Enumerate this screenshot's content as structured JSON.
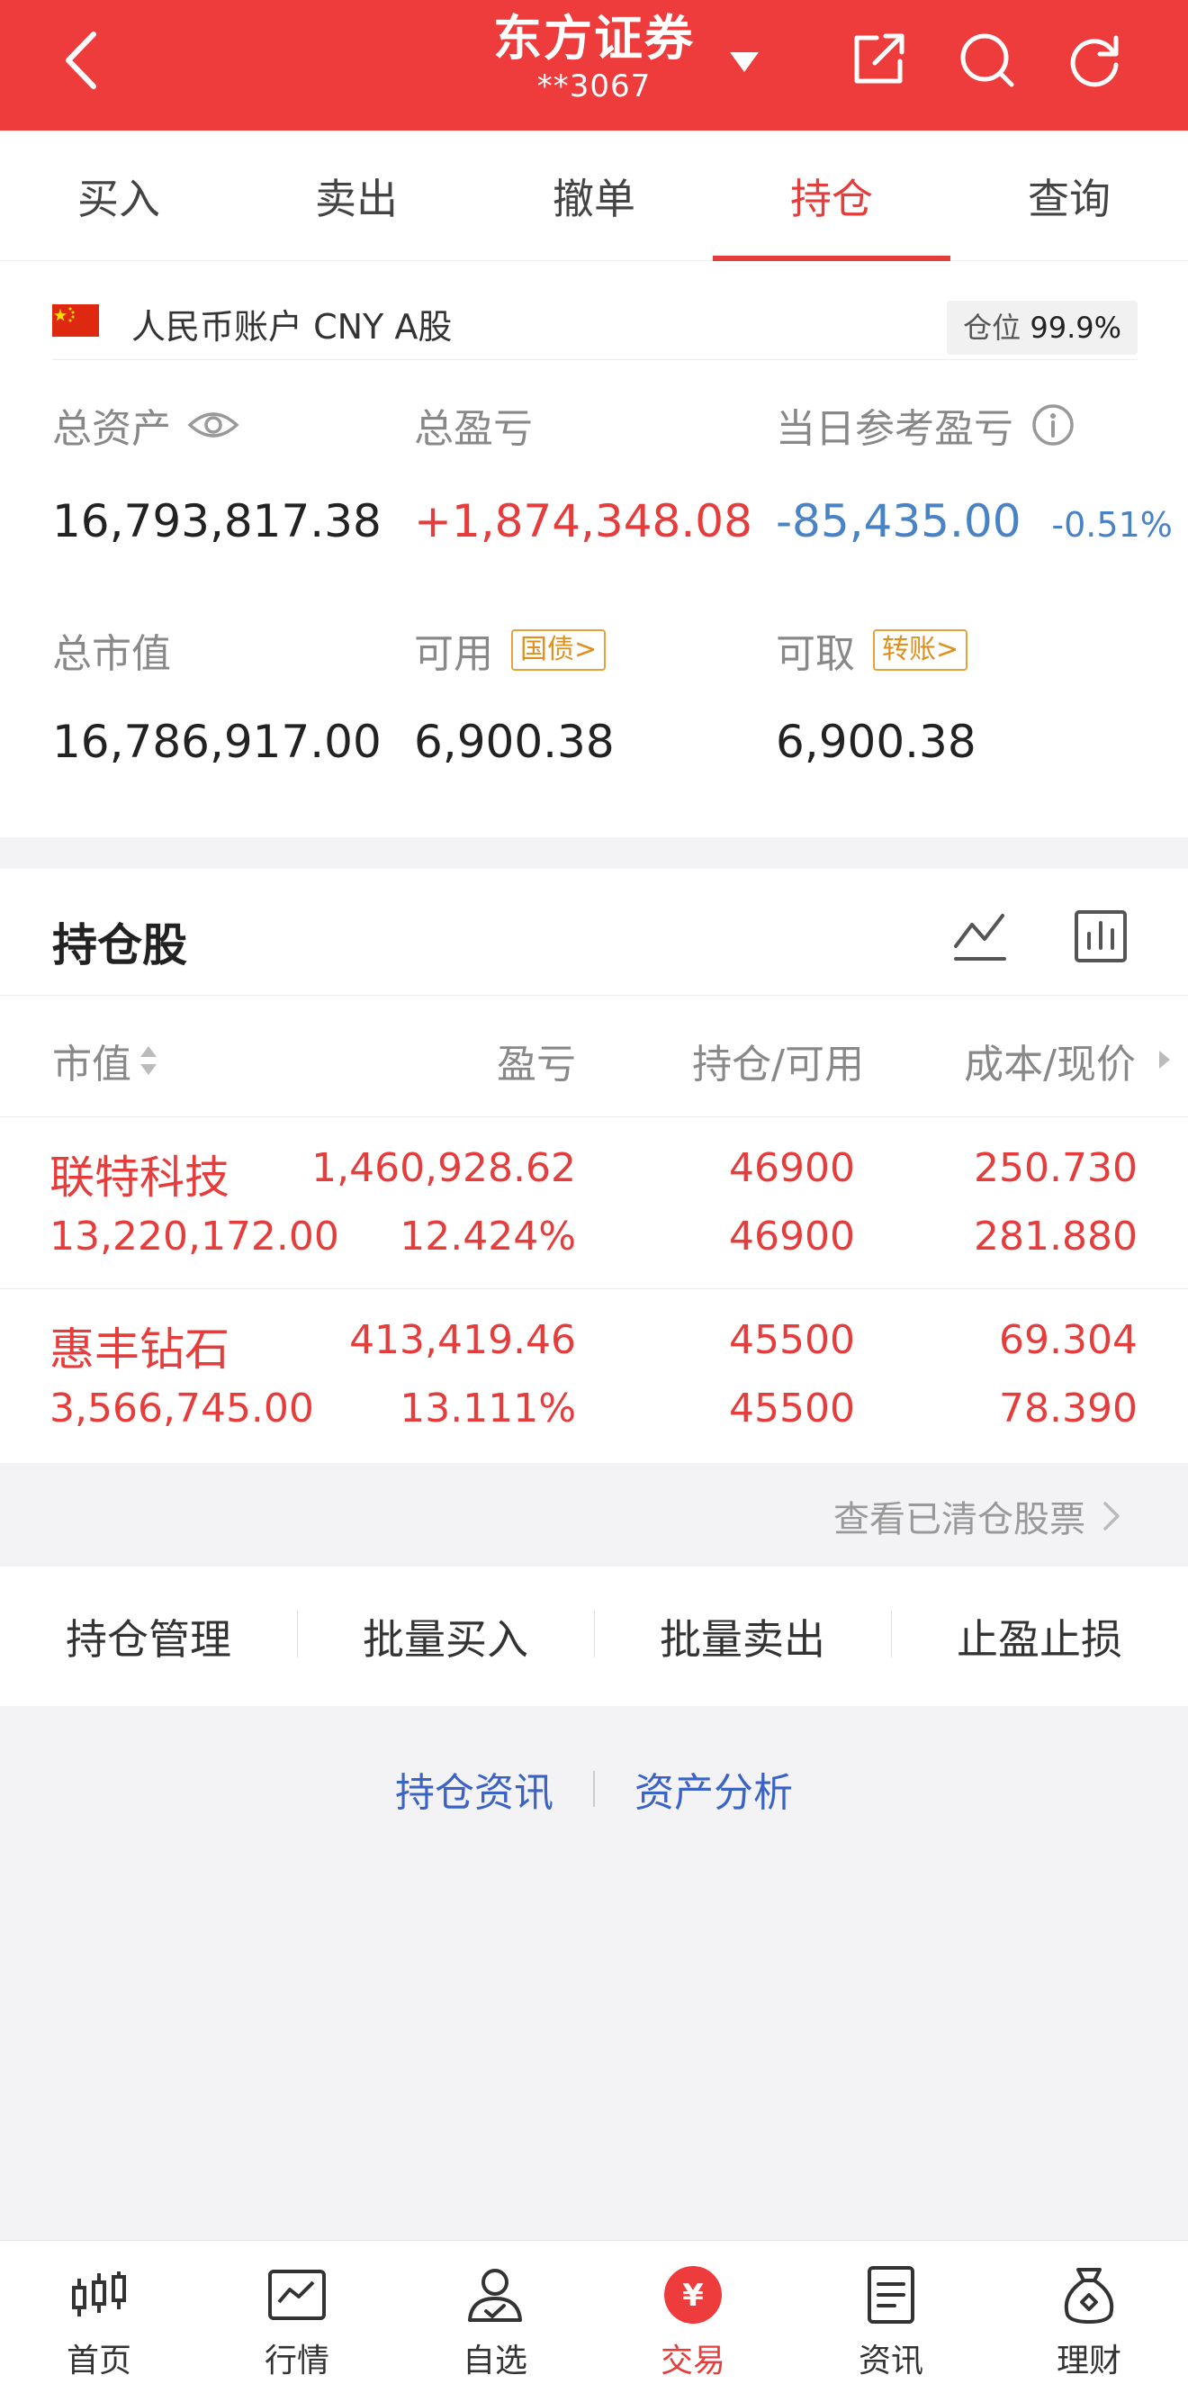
{
  "header": {
    "title": "东方证券",
    "account_mask": "**3067",
    "colors": {
      "brand": "#ee3b3b",
      "up": "#e53c3c",
      "down": "#4a83c5"
    },
    "icons": [
      "back-icon",
      "dropdown-caret-icon",
      "share-icon",
      "search-icon",
      "refresh-icon"
    ]
  },
  "tabs": [
    {
      "label": "买入"
    },
    {
      "label": "卖出"
    },
    {
      "label": "撤单"
    },
    {
      "label": "持仓",
      "active": true
    },
    {
      "label": "查询"
    }
  ],
  "account": {
    "currency_label": "人民币账户 CNY A股",
    "position_label": "仓位",
    "position_value": "99.9%",
    "total_assets_label": "总资产",
    "total_assets": "16,793,817.38",
    "total_pnl_label": "总盈亏",
    "total_pnl": "+1,874,348.08",
    "daily_pnl_label": "当日参考盈亏",
    "daily_pnl": "-85,435.00",
    "daily_pnl_pct": "-0.51%",
    "market_value_label": "总市值",
    "market_value": "16,786,917.00",
    "available_label": "可用",
    "available_tag": "国债>",
    "available": "6,900.38",
    "withdrawable_label": "可取",
    "withdrawable_tag": "转账>",
    "withdrawable": "6,900.38"
  },
  "holdings": {
    "title": "持仓股",
    "columns": {
      "market_value": "市值",
      "pnl": "盈亏",
      "position": "持仓/可用",
      "cost_price": "成本/现价"
    },
    "rows": [
      {
        "name": "联特科技",
        "market_value": "13,220,172.00",
        "pnl": "1,460,928.62",
        "pnl_pct": "12.424%",
        "position": "46900",
        "available": "46900",
        "cost": "250.730",
        "price": "281.880"
      },
      {
        "name": "惠丰钻石",
        "market_value": "3,566,745.00",
        "pnl": "413,419.46",
        "pnl_pct": "13.111%",
        "position": "45500",
        "available": "45500",
        "cost": "69.304",
        "price": "78.390"
      }
    ]
  },
  "cleared_link": "查看已清仓股票",
  "actions": [
    "持仓管理",
    "批量买入",
    "批量卖出",
    "止盈止损"
  ],
  "links": [
    "持仓资讯",
    "资产分析"
  ],
  "bottom_nav": [
    {
      "label": "首页",
      "icon": "candlestick-icon"
    },
    {
      "label": "行情",
      "icon": "chart-icon"
    },
    {
      "label": "自选",
      "icon": "user-check-icon"
    },
    {
      "label": "交易",
      "icon": "yuan-coin-icon",
      "active": true
    },
    {
      "label": "资讯",
      "icon": "document-icon"
    },
    {
      "label": "理财",
      "icon": "money-bag-icon"
    }
  ]
}
